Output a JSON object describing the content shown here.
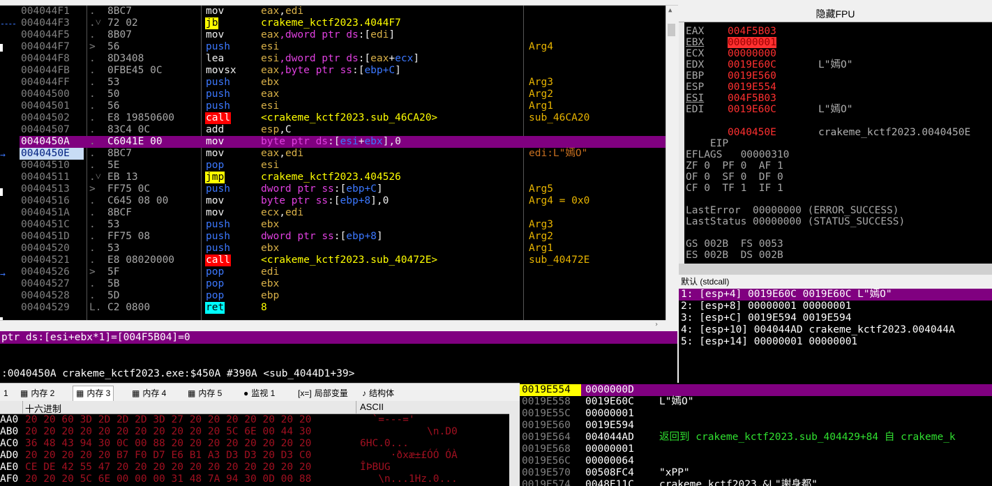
{
  "disasm": {
    "rows": [
      {
        "addr": "004044F1",
        "mk": ".",
        "bytes": "8BC7",
        "mnem": "mov",
        "mclass": "plain",
        "ops": [
          [
            "eax",
            "reg"
          ],
          [
            ",",
            "p"
          ],
          [
            "edi",
            "reg"
          ]
        ],
        "cmt": ""
      },
      {
        "addr": "004044F3",
        "mk": ".˅",
        "bytes": "72 02",
        "mnem": "jb",
        "mclass": "jcc",
        "ops": [
          [
            "crakeme_kctf2023.4044F7",
            "lbl"
          ]
        ],
        "cmt": ""
      },
      {
        "addr": "004044F5",
        "mk": ".",
        "bytes": "8B07",
        "mnem": "mov",
        "mclass": "plain",
        "ops": [
          [
            "eax",
            "reg"
          ],
          [
            ",dword ptr ",
            "kw"
          ],
          [
            "ds",
            "seg"
          ],
          [
            ":[",
            "p"
          ],
          [
            "edi",
            "reg"
          ],
          [
            "]",
            "p"
          ]
        ],
        "cmt": ""
      },
      {
        "addr": "004044F7",
        "mk": ">",
        "bytes": "56",
        "mnem": "push",
        "mclass": "push",
        "ops": [
          [
            "esi",
            "reg"
          ]
        ],
        "cmt": "Arg4"
      },
      {
        "addr": "004044F8",
        "mk": ".",
        "bytes": "8D3408",
        "mnem": "lea",
        "mclass": "plain",
        "ops": [
          [
            "esi",
            "reg"
          ],
          [
            ",dword ptr ",
            "kw"
          ],
          [
            "ds",
            "seg"
          ],
          [
            ":[",
            "p"
          ],
          [
            "eax",
            "reg"
          ],
          [
            "+",
            "p"
          ],
          [
            "ecx",
            "reg2"
          ],
          [
            "]",
            "p"
          ]
        ],
        "cmt": ""
      },
      {
        "addr": "004044FB",
        "mk": ".",
        "bytes": "0FBE45 0C",
        "mnem": "movsx",
        "mclass": "plain",
        "ops": [
          [
            "eax",
            "reg"
          ],
          [
            ",byte ptr ",
            "kw"
          ],
          [
            "ss",
            "seg"
          ],
          [
            ":[",
            "p"
          ],
          [
            "ebp+C",
            "reg2"
          ],
          [
            "]",
            "p"
          ]
        ],
        "cmt": ""
      },
      {
        "addr": "004044FF",
        "mk": ".",
        "bytes": "53",
        "mnem": "push",
        "mclass": "push",
        "ops": [
          [
            "ebx",
            "reg"
          ]
        ],
        "cmt": "Arg3"
      },
      {
        "addr": "00404500",
        "mk": ".",
        "bytes": "50",
        "mnem": "push",
        "mclass": "push",
        "ops": [
          [
            "eax",
            "reg"
          ]
        ],
        "cmt": "Arg2"
      },
      {
        "addr": "00404501",
        "mk": ".",
        "bytes": "56",
        "mnem": "push",
        "mclass": "push",
        "ops": [
          [
            "esi",
            "reg"
          ]
        ],
        "cmt": "Arg1"
      },
      {
        "addr": "00404502",
        "mk": ".",
        "bytes": "E8 19850600",
        "mnem": "call",
        "mclass": "call",
        "ops": [
          [
            "<crakeme_kctf2023.sub_46CA20>",
            "lbl"
          ]
        ],
        "cmt": "sub_46CA20"
      },
      {
        "addr": "00404507",
        "mk": ".",
        "bytes": "83C4 0C",
        "mnem": "add",
        "mclass": "plain",
        "ops": [
          [
            "esp",
            "reg"
          ],
          [
            ",C",
            "p"
          ]
        ],
        "cmt": ""
      },
      {
        "addr": "0040450A",
        "mk": ".",
        "bytes": "C6041E 00",
        "mnem": "mov",
        "mclass": "plain",
        "ops": [
          [
            "byte ptr ",
            "kw"
          ],
          [
            "ds",
            "seg"
          ],
          [
            ":[",
            "p"
          ],
          [
            "esi",
            "reg2"
          ],
          [
            "+",
            "p"
          ],
          [
            "ebx",
            "reg2"
          ],
          [
            "]",
            "p"
          ],
          [
            ",0",
            "p"
          ]
        ],
        "cmt": "",
        "sel": true
      },
      {
        "addr": "0040450E",
        "mk": ".",
        "bytes": "8BC7",
        "mnem": "mov",
        "mclass": "plain",
        "ops": [
          [
            "eax",
            "reg"
          ],
          [
            ",",
            "p"
          ],
          [
            "edi",
            "reg"
          ]
        ],
        "cmt": "edi:L\"嫣O\"",
        "cmtc": "#c87020",
        "cur": true
      },
      {
        "addr": "00404510",
        "mk": ".",
        "bytes": "5E",
        "mnem": "pop",
        "mclass": "push",
        "ops": [
          [
            "esi",
            "reg"
          ]
        ],
        "cmt": ""
      },
      {
        "addr": "00404511",
        "mk": ".˅",
        "bytes": "EB 13",
        "mnem": "jmp",
        "mclass": "jcc",
        "ops": [
          [
            "crakeme_kctf2023.404526",
            "lbl"
          ]
        ],
        "cmt": ""
      },
      {
        "addr": "00404513",
        "mk": ">",
        "bytes": "FF75 0C",
        "mnem": "push",
        "mclass": "push",
        "ops": [
          [
            "dword ptr ",
            "kw"
          ],
          [
            "ss",
            "seg"
          ],
          [
            ":[",
            "p"
          ],
          [
            "ebp+C",
            "reg2"
          ],
          [
            "]",
            "p"
          ]
        ],
        "cmt": "Arg5"
      },
      {
        "addr": "00404516",
        "mk": ".",
        "bytes": "C645 08 00",
        "mnem": "mov",
        "mclass": "plain",
        "ops": [
          [
            "byte ptr ",
            "kw"
          ],
          [
            "ss",
            "seg"
          ],
          [
            ":[",
            "p"
          ],
          [
            "ebp+8",
            "reg2"
          ],
          [
            "],0",
            "p"
          ]
        ],
        "cmt": "Arg4 = 0x0"
      },
      {
        "addr": "0040451A",
        "mk": ".",
        "bytes": "8BCF",
        "mnem": "mov",
        "mclass": "plain",
        "ops": [
          [
            "ecx",
            "reg"
          ],
          [
            ",",
            "p"
          ],
          [
            "edi",
            "reg"
          ]
        ],
        "cmt": ""
      },
      {
        "addr": "0040451C",
        "mk": ".",
        "bytes": "53",
        "mnem": "push",
        "mclass": "push",
        "ops": [
          [
            "ebx",
            "reg"
          ]
        ],
        "cmt": "Arg3"
      },
      {
        "addr": "0040451D",
        "mk": ".",
        "bytes": "FF75 08",
        "mnem": "push",
        "mclass": "push",
        "ops": [
          [
            "dword ptr ",
            "kw"
          ],
          [
            "ss",
            "seg"
          ],
          [
            ":[",
            "p"
          ],
          [
            "ebp+8",
            "reg2"
          ],
          [
            "]",
            "p"
          ]
        ],
        "cmt": "Arg2"
      },
      {
        "addr": "00404520",
        "mk": ".",
        "bytes": "53",
        "mnem": "push",
        "mclass": "push",
        "ops": [
          [
            "ebx",
            "reg"
          ]
        ],
        "cmt": "Arg1"
      },
      {
        "addr": "00404521",
        "mk": ".",
        "bytes": "E8 08020000",
        "mnem": "call",
        "mclass": "call",
        "ops": [
          [
            "<crakeme_kctf2023.sub_40472E>",
            "lbl"
          ]
        ],
        "cmt": "sub_40472E"
      },
      {
        "addr": "00404526",
        "mk": ">",
        "bytes": "5F",
        "mnem": "pop",
        "mclass": "push",
        "ops": [
          [
            "edi",
            "reg"
          ]
        ],
        "cmt": ""
      },
      {
        "addr": "00404527",
        "mk": ".",
        "bytes": "5B",
        "mnem": "pop",
        "mclass": "push",
        "ops": [
          [
            "ebx",
            "reg"
          ]
        ],
        "cmt": ""
      },
      {
        "addr": "00404528",
        "mk": ".",
        "bytes": "5D",
        "mnem": "pop",
        "mclass": "push",
        "ops": [
          [
            "ebp",
            "reg"
          ]
        ],
        "cmt": ""
      },
      {
        "addr": "00404529",
        "mk": "L.",
        "bytes": "C2 0800",
        "mnem": "ret",
        "mclass": "ret",
        "ops": [
          [
            "8",
            "lbl"
          ]
        ],
        "cmt": ""
      }
    ]
  },
  "info": {
    "line1": "ptr ds:[esi+ebx*1]=[004F5B04]=0",
    "line2": ":0040450A crakeme_kctf2023.exe:$450A #390A <sub_4044D1+39>"
  },
  "regs": {
    "title": "隐藏FPU",
    "list": [
      {
        "n": "EAX",
        "v": "004F5B03",
        "c": ""
      },
      {
        "n": "EBX",
        "v": "00000001",
        "c": "",
        "hl": true,
        "u": true
      },
      {
        "n": "ECX",
        "v": "00000000",
        "c": ""
      },
      {
        "n": "EDX",
        "v": "0019E60C",
        "c": "L\"嫣O\""
      },
      {
        "n": "EBP",
        "v": "0019E560",
        "c": ""
      },
      {
        "n": "ESP",
        "v": "0019E554",
        "c": ""
      },
      {
        "n": "ESI",
        "v": "004F5B03",
        "c": "",
        "u": true
      },
      {
        "n": "EDI",
        "v": "0019E60C",
        "c": "L\"嫣O\""
      }
    ],
    "eip": {
      "n": "EIP",
      "v": "0040450E",
      "c": "crakeme_kctf2023.0040450E"
    },
    "eflags": "EFLAGS   00000310",
    "flags1": "ZF 0  PF 0  AF 1",
    "flags2": "OF 0  SF 0  DF 0",
    "flags3": "CF 0  TF 1  IF 1",
    "lasterror": "LastError  00000000 (ERROR_SUCCESS)",
    "laststatus": "LastStatus 00000000 (STATUS_SUCCESS)",
    "seg1": "GS 002B  FS 0053",
    "seg2": "ES 002B  DS 002B"
  },
  "stackargs": {
    "header": "默认 (stdcall)",
    "list": [
      "1: [esp+4] 0019E60C 0019E60C L\"嫣O\"",
      "2: [esp+8] 00000001 00000001",
      "3: [esp+C] 0019E594 0019E594",
      "4: [esp+10] 004044AD crakeme_kctf2023.004044A",
      "5: [esp+14] 00000001 00000001"
    ]
  },
  "tabs": [
    {
      "label": "1",
      "icon": ""
    },
    {
      "label": "内存 2",
      "icon": "▦"
    },
    {
      "label": "内存 3",
      "icon": "▦",
      "active": true
    },
    {
      "label": "内存 4",
      "icon": "▦"
    },
    {
      "label": "内存 5",
      "icon": "▦"
    },
    {
      "label": "监视 1",
      "icon": "●"
    },
    {
      "label": "局部变量",
      "icon": "[x=]"
    },
    {
      "label": "结构体",
      "icon": "♪"
    }
  ],
  "dump": {
    "hex_header": "十六进制",
    "ascii_header": "ASCII",
    "rows": [
      {
        "a": "AA0",
        "h": "20 20 60 3D 2D 2D 2D 3D 27 20 20 20 20 20 20 20",
        "s": "  `=---='"
      },
      {
        "a": "AB0",
        "h": "20 20 20 20 20 20 20 20 20 20 20 5C 6E 00 44 30",
        "s": "           \\n.D0"
      },
      {
        "a": "AC0",
        "h": "36 48 43 94 30 0C 00 88 20 20 20 20 20 20 20 20",
        "s": "6HC.0..."
      },
      {
        "a": "AD0",
        "h": "20 20 20 20 20 B7 F0 D7 E6 B1 A3 D3 D3 20 D3 C0",
        "s": "     ·ðxæ±£ÓÓ ÓÀ"
      },
      {
        "a": "AE0",
        "h": "CE DE 42 55 47 20 20 20 20 20 20 20 20 20 20 20",
        "s": "ÎÞBUG"
      },
      {
        "a": "AF0",
        "h": "20 20 20 5C 6E 00 00 00 31 48 7A 94 30 0D 00 88",
        "s": "   \\n...1Hz.0..."
      }
    ]
  },
  "stackmem": {
    "rows": [
      {
        "a": "0019E554",
        "v": "0000000D",
        "c": "",
        "sel": true
      },
      {
        "a": "0019E558",
        "v": "0019E60C",
        "c": "L\"嫣O\""
      },
      {
        "a": "0019E55C",
        "v": "00000001",
        "c": ""
      },
      {
        "a": "0019E560",
        "v": "0019E594",
        "c": ""
      },
      {
        "a": "0019E564",
        "v": "004044AD",
        "c": "返回到 crakeme_kctf2023.sub_404429+84 自 crakeme_k",
        "ret": true
      },
      {
        "a": "0019E568",
        "v": "00000001",
        "c": ""
      },
      {
        "a": "0019E56C",
        "v": "00000064",
        "c": ""
      },
      {
        "a": "0019E570",
        "v": "00508FC4",
        "c": "\"xPP\""
      },
      {
        "a": "0019E574",
        "v": "0048E11C",
        "c": "crakeme_kctf2023.&L\"謝身都\""
      }
    ]
  },
  "colors": {
    "selection": "#800080",
    "register_value": "#ff3030",
    "label": "#ffff00",
    "comment": "#e8b400"
  }
}
